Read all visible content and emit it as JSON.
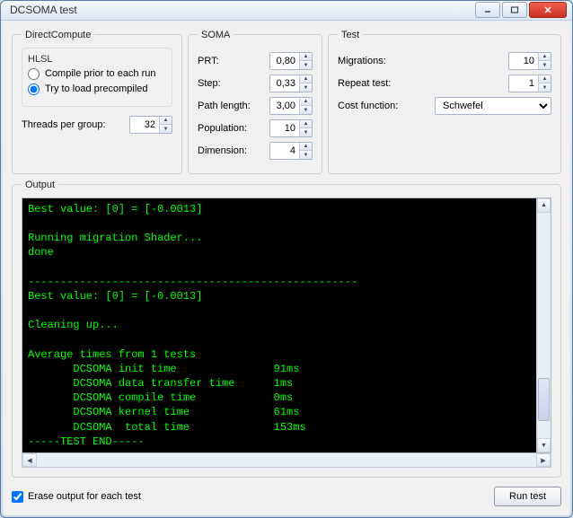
{
  "window": {
    "title": "DCSOMA test"
  },
  "groups": {
    "directcompute": "DirectCompute",
    "hlsl": "HLSL",
    "soma": "SOMA",
    "test": "Test",
    "output": "Output"
  },
  "hlsl": {
    "compile_each": "Compile prior to each run",
    "load_precompiled": "Try to load precompiled",
    "selected": "load_precompiled"
  },
  "dc": {
    "threads_label": "Threads per group:",
    "threads_value": "32"
  },
  "soma": {
    "prt_label": "PRT:",
    "prt_value": "0,80",
    "step_label": "Step:",
    "step_value": "0,33",
    "path_label": "Path length:",
    "path_value": "3,00",
    "pop_label": "Population:",
    "pop_value": "10",
    "dim_label": "Dimension:",
    "dim_value": "4"
  },
  "test": {
    "migrations_label": "Migrations:",
    "migrations_value": "10",
    "repeat_label": "Repeat test:",
    "repeat_value": "1",
    "cost_label": "Cost function:",
    "cost_value": "Schwefel"
  },
  "output_text": "Best value: [0] = [-0.0013]\n\nRunning migration Shader...\ndone\n\n---------------------------------------------------\nBest value: [0] = [-0.0013]\n\nCleaning up...\n\nAverage times from 1 tests\n       DCSOMA init time               91ms\n       DCSOMA data transfer time      1ms\n       DCSOMA compile time            0ms\n       DCSOMA kernel time             61ms\n       DCSOMA  total time             153ms\n-----TEST END-----",
  "bottom": {
    "erase_label": "Erase output for each test",
    "erase_checked": true,
    "run_label": "Run test"
  }
}
